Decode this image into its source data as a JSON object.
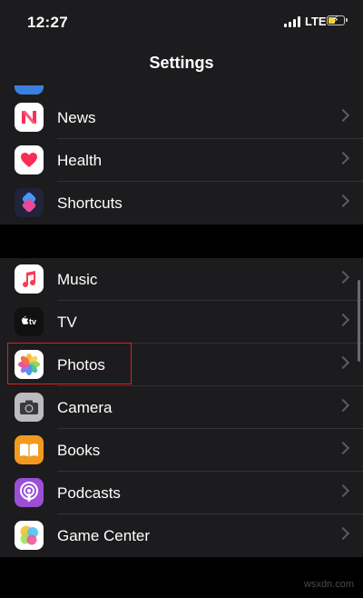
{
  "status_bar": {
    "time": "12:27",
    "network": "LTE"
  },
  "nav": {
    "title": "Settings"
  },
  "groups": [
    {
      "items": [
        {
          "label": "News",
          "icon": "news-icon"
        },
        {
          "label": "Health",
          "icon": "health-icon"
        },
        {
          "label": "Shortcuts",
          "icon": "shortcuts-icon"
        }
      ]
    },
    {
      "items": [
        {
          "label": "Music",
          "icon": "music-icon"
        },
        {
          "label": "TV",
          "icon": "tv-icon",
          "icon_text": "tv"
        },
        {
          "label": "Photos",
          "icon": "photos-icon",
          "highlighted": true
        },
        {
          "label": "Camera",
          "icon": "camera-icon"
        },
        {
          "label": "Books",
          "icon": "books-icon"
        },
        {
          "label": "Podcasts",
          "icon": "podcasts-icon"
        },
        {
          "label": "Game Center",
          "icon": "game-center-icon"
        }
      ]
    }
  ],
  "watermark": "wsxdn.com",
  "colors": {
    "highlight": "#e0201c",
    "background": "#000000",
    "cell": "#1c1c1e"
  }
}
